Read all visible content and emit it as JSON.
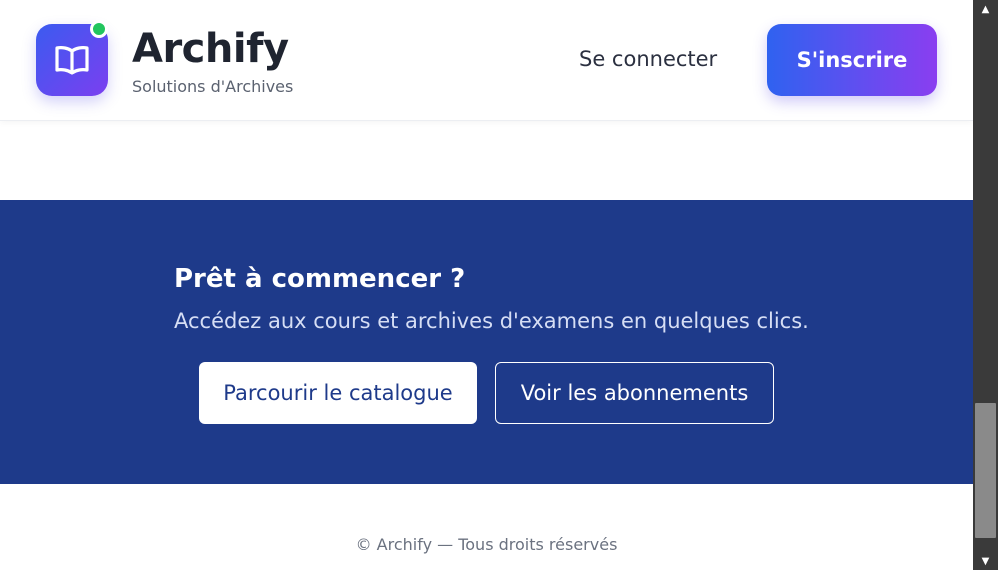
{
  "header": {
    "brand_name": "Archify",
    "brand_tagline": "Solutions d'Archives",
    "logo_icon": "book-icon",
    "status_color": "#22c55e",
    "login_label": "Se connecter",
    "signup_label": "S'inscrire"
  },
  "cta": {
    "title": "Prêt à commencer ?",
    "subtitle": "Accédez aux cours et archives d'examens en quelques clics.",
    "catalog_label": "Parcourir le catalogue",
    "plans_label": "Voir les abonnements",
    "background_color": "#1e3a8a"
  },
  "footer": {
    "copyright": "© Archify — Tous droits réservés"
  },
  "scrollbar": {
    "up_icon": "arrow-up-icon",
    "down_icon": "arrow-down-icon"
  }
}
